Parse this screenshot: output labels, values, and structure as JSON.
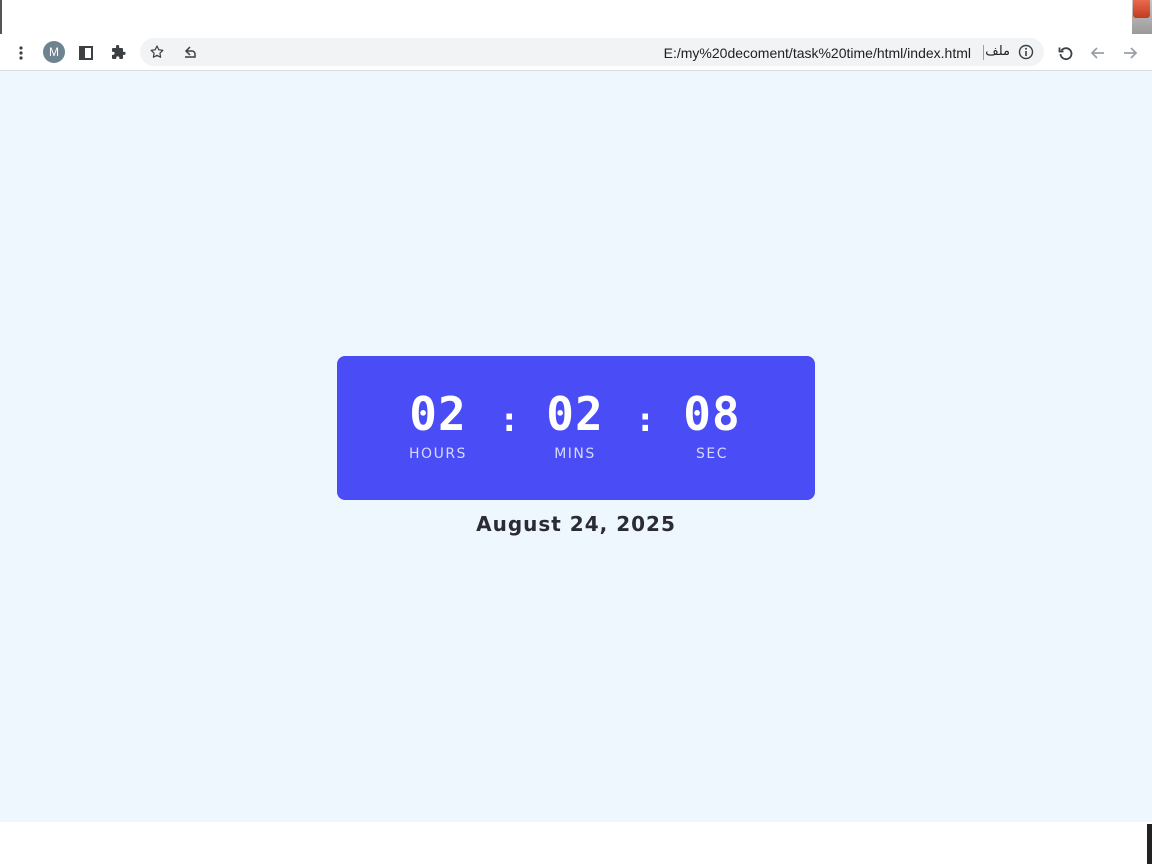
{
  "browser": {
    "profile_initial": "M",
    "url": "E:/my%20decoment/task%20time/html/index.html",
    "file_label": "ملف",
    "icons": {
      "menu": "kebab-menu-icon",
      "side_panel": "side-panel-icon",
      "extensions": "puzzle-icon",
      "bookmark": "star-icon",
      "share": "share-icon",
      "site_info": "info-icon",
      "reload": "reload-icon",
      "back": "back-arrow-icon",
      "forward": "forward-arrow-icon"
    }
  },
  "clock": {
    "hours": "02",
    "minutes": "02",
    "seconds": "08",
    "separator": ":",
    "labels": {
      "hours": "HOURS",
      "minutes": "MINS",
      "seconds": "SEC"
    }
  },
  "date": "August 24, 2025",
  "colors": {
    "page_background": "#eef6fe",
    "card_background": "#4a4df5",
    "digits": "#ffffff",
    "unit_labels": "#d6d8ff",
    "date_text": "#2b2b33"
  }
}
